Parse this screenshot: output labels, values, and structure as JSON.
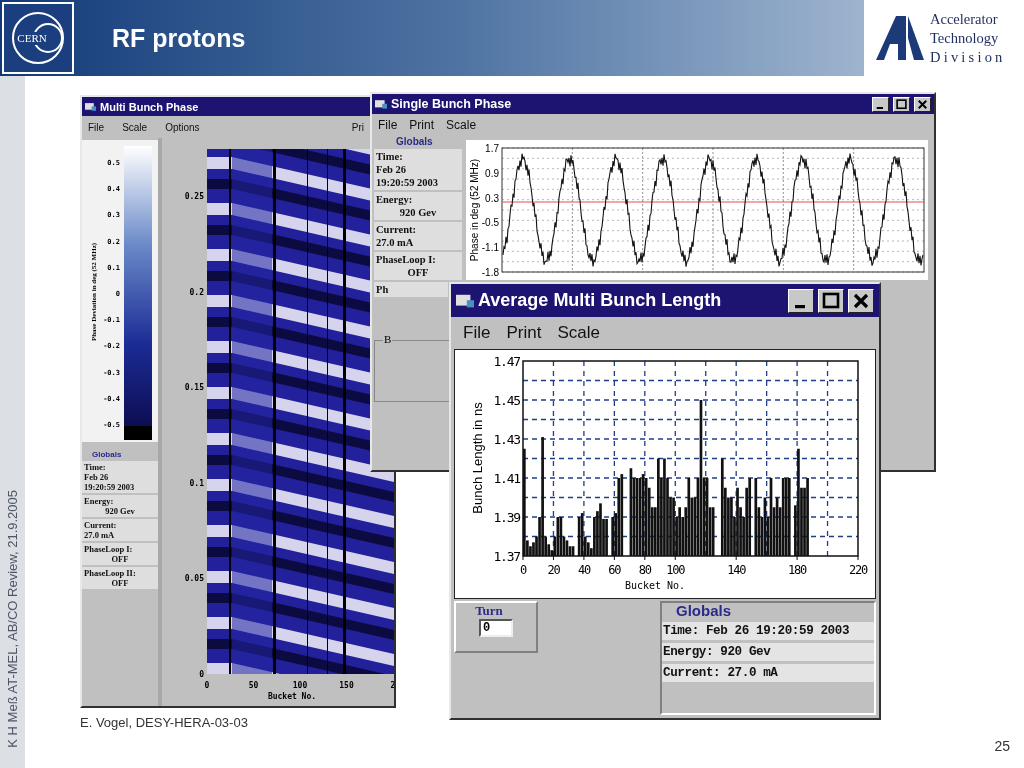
{
  "header": {
    "logo_text": "CERN",
    "title": "RF protons",
    "division_lines": [
      "Accelerator",
      "Technology",
      "Division"
    ]
  },
  "side_note": "K H Meß AT-MEL, AB/CO Review, 21.9.2005",
  "windows": [
    {
      "kind": "heatmap",
      "title": "Multi Bunch Phase",
      "menu": [
        "File",
        "Scale",
        "Options"
      ],
      "menu_right": [
        "Pri"
      ],
      "scale": {
        "label": "Phase Deviation in deg (52 MHz)",
        "ticks": [
          "0.5",
          "0.4",
          "0.3",
          "0.2",
          "0.1",
          "0",
          "-0.1",
          "-0.2",
          "-0.3",
          "-0.4",
          "-0.5"
        ]
      },
      "globals": {
        "title": "Globals",
        "fields": [
          {
            "label": "Time:",
            "lines": [
              "Feb 26",
              "19:20:59 2003"
            ],
            "centered": false
          },
          {
            "label": "Energy:",
            "lines": [
              "920 Gev"
            ],
            "centered": true
          },
          {
            "label": "Current:",
            "lines": [
              "27.0 mA"
            ],
            "centered": false
          },
          {
            "label": "PhaseLoop I:",
            "lines": [
              "OFF"
            ],
            "centered": true
          },
          {
            "label": "PhaseLoop II:",
            "lines": [
              "OFF"
            ],
            "centered": true
          }
        ]
      },
      "plot": {
        "y_tick_labels": [
          "0.25",
          "0.2",
          "0.15",
          "0.1",
          "0.05",
          "0"
        ],
        "x_tick_labels": [
          "0",
          "50",
          "100",
          "150",
          "2"
        ],
        "xlabel": "Bucket No."
      }
    },
    {
      "kind": "waveform",
      "title": "Single Bunch Phase",
      "menu": [
        "File",
        "Print",
        "Scale"
      ],
      "globals": {
        "title": "Globals",
        "fields": [
          {
            "label": "Time:",
            "lines": [
              "Feb 26",
              "19:20:59 2003"
            ],
            "centered": false
          },
          {
            "label": "Energy:",
            "lines": [
              "920 Gev"
            ],
            "centered": true
          },
          {
            "label": "Current:",
            "lines": [
              "27.0 mA"
            ],
            "centered": false
          },
          {
            "label": "PhaseLoop I:",
            "lines": [
              "OFF"
            ],
            "centered": true
          },
          {
            "label": "Ph"
          }
        ]
      },
      "group_label": "B",
      "plot": {
        "ylabel": "Phase in deg (52 MHz)",
        "y_tick_labels": [
          "1.7",
          "0.9",
          "0.3",
          "-0.5",
          "-1.1",
          "-1.8"
        ]
      }
    },
    {
      "kind": "bars",
      "title": "Average Multi Bunch Length",
      "menu": [
        "File",
        "Print",
        "Scale"
      ],
      "chart_data": {
        "type": "bar",
        "grid": true,
        "xlabel": "Bucket No.",
        "ylabel": "Bunch Length in ns",
        "xlim": [
          0,
          220
        ],
        "ylim": [
          1.37,
          1.47
        ],
        "xticks": [
          0,
          20,
          40,
          60,
          80,
          100,
          140,
          180,
          220
        ],
        "yticks": [
          1.37,
          1.39,
          1.41,
          1.43,
          1.45,
          1.47
        ],
        "x": [
          0,
          2,
          4,
          6,
          8,
          10,
          12,
          14,
          16,
          18,
          20,
          22,
          24,
          26,
          28,
          30,
          32,
          36,
          38,
          40,
          42,
          44,
          46,
          48,
          50,
          52,
          54,
          58,
          60,
          62,
          64,
          70,
          72,
          74,
          76,
          78,
          80,
          82,
          84,
          86,
          88,
          90,
          92,
          94,
          96,
          98,
          100,
          102,
          104,
          106,
          108,
          110,
          112,
          114,
          116,
          118,
          120,
          122,
          124,
          130,
          132,
          134,
          136,
          138,
          140,
          142,
          144,
          146,
          148,
          152,
          154,
          156,
          158,
          160,
          162,
          164,
          166,
          168,
          170,
          172,
          174,
          178,
          180,
          182,
          184,
          186
        ],
        "series": [
          {
            "color": "#111111",
            "values": [
              1.425,
              1.378,
              1.375,
              1.377,
              1.38,
              1.39,
              1.431,
              1.38,
              1.376,
              1.373,
              1.38,
              1.39,
              1.39,
              1.38,
              1.378,
              1.375,
              1.375,
              1.39,
              1.392,
              1.38,
              1.377,
              1.374,
              1.39,
              1.393,
              1.397,
              1.389,
              1.389,
              1.39,
              1.392,
              1.41,
              1.412,
              1.415,
              1.41,
              1.41,
              1.41,
              1.412,
              1.41,
              1.405,
              1.395,
              1.395,
              1.42,
              1.41,
              1.42,
              1.41,
              1.4,
              1.4,
              1.39,
              1.395,
              1.39,
              1.395,
              1.41,
              1.4,
              1.4,
              1.41,
              1.45,
              1.41,
              1.41,
              1.395,
              1.395,
              1.42,
              1.405,
              1.4,
              1.4,
              1.39,
              1.405,
              1.395,
              1.39,
              1.405,
              1.41,
              1.41,
              1.395,
              1.39,
              1.4,
              1.39,
              1.41,
              1.395,
              1.4,
              1.395,
              1.41,
              1.41,
              1.41,
              1.396,
              1.425,
              1.405,
              1.405,
              1.41
            ]
          }
        ]
      },
      "turn": {
        "label": "Turn",
        "value": "0"
      },
      "globals": {
        "title": "Globals",
        "lines": [
          "Time: Feb 26 19:20:59 2003",
          "Energy: 920 Gev",
          "Current: 27.0 mA"
        ]
      }
    }
  ],
  "footer": {
    "credit": "E. Vogel, DESY-HERA-03-03",
    "page": "25"
  }
}
